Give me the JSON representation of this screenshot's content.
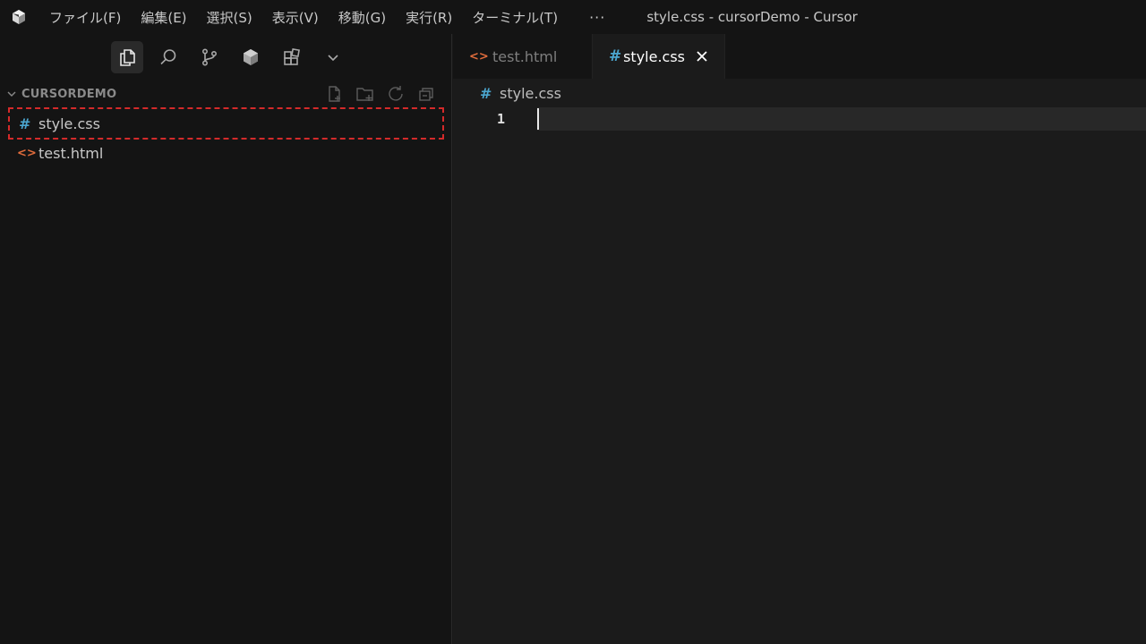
{
  "window": {
    "title": "style.css - cursorDemo - Cursor"
  },
  "menu": {
    "items": [
      "ファイル(F)",
      "編集(E)",
      "選択(S)",
      "表示(V)",
      "移動(G)",
      "実行(R)",
      "ターミナル(T)"
    ],
    "more": "···"
  },
  "activity_bar": {
    "icons": [
      "explorer-icon",
      "search-icon",
      "source-control-icon",
      "extensions-cube-icon",
      "grid-icon",
      "chevron-down-icon"
    ],
    "active": "explorer-icon"
  },
  "explorer": {
    "folder_name": "CURSORDEMO",
    "actions": [
      "new-file-icon",
      "new-folder-icon",
      "refresh-icon",
      "collapse-all-icon"
    ],
    "files": [
      {
        "name": "style.css",
        "icon": "#",
        "type": "css",
        "selected": true
      },
      {
        "name": "test.html",
        "icon": "<>",
        "type": "html",
        "selected": false
      }
    ]
  },
  "tabs": [
    {
      "label": "test.html",
      "icon": "<>",
      "active": false
    },
    {
      "label": "style.css",
      "icon": "#",
      "active": true
    }
  ],
  "breadcrumb": {
    "icon": "#",
    "label": "style.css"
  },
  "editor": {
    "lines": [
      {
        "number": "1",
        "text": ""
      }
    ]
  },
  "colors": {
    "css_icon": "#4ba6cf",
    "html_icon": "#e06c3c",
    "highlight_border": "#d42a2a"
  }
}
